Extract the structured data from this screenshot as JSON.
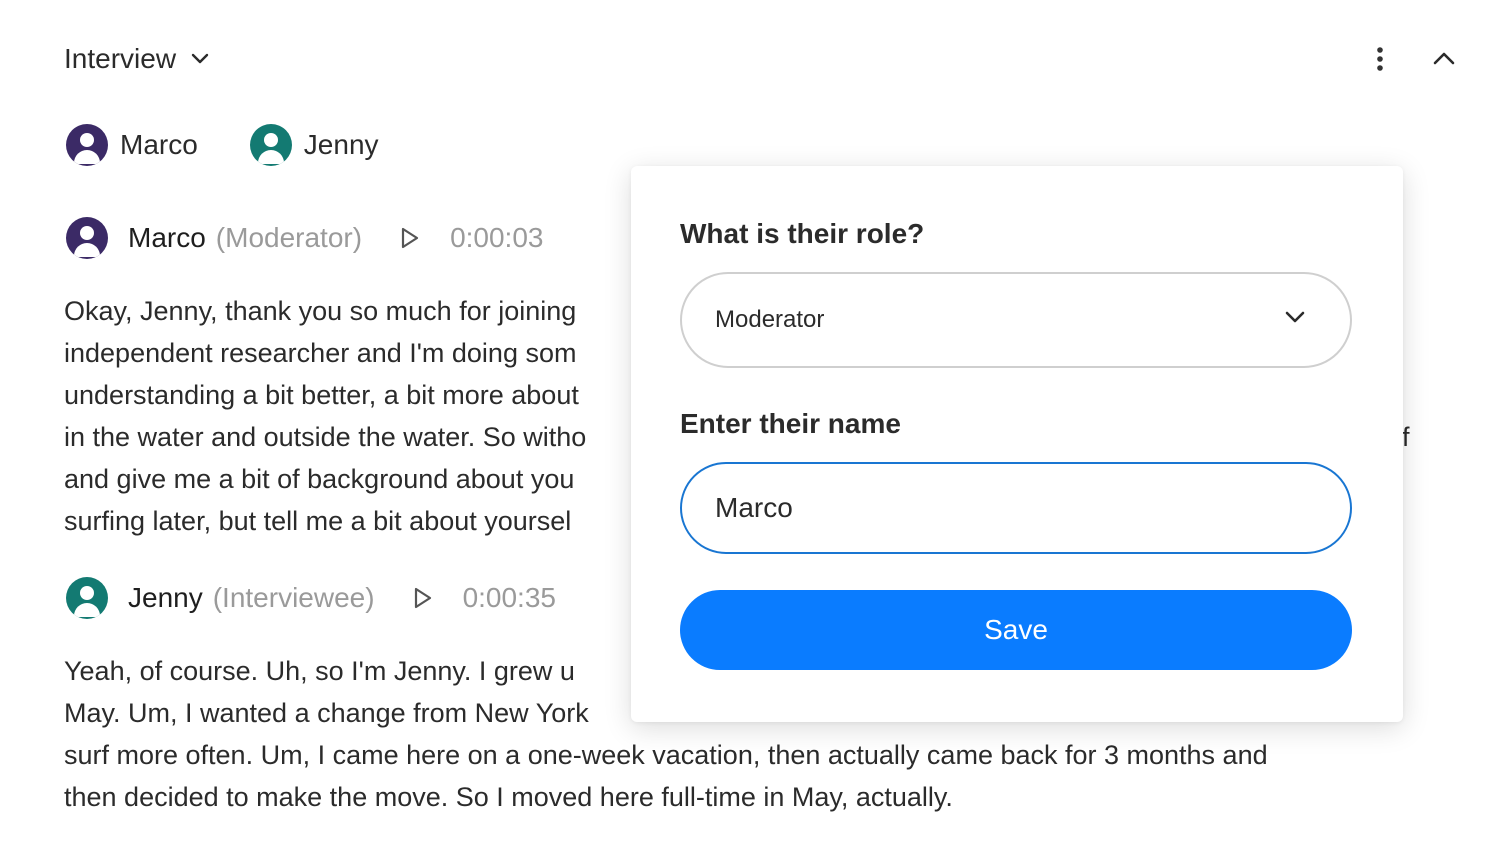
{
  "colors": {
    "marco_avatar": "#3b2a66",
    "jenny_avatar": "#137a72",
    "primary": "#0a7cff",
    "input_focus": "#1976d2",
    "muted_text": "#9a9a9a"
  },
  "header": {
    "title": "Interview",
    "dropdown_icon": "chevron-down-icon",
    "more_icon": "kebab-icon",
    "collapse_icon": "chevron-up-icon"
  },
  "speakers": [
    {
      "name": "Marco",
      "icon": "user-avatar-icon"
    },
    {
      "name": "Jenny",
      "icon": "user-avatar-icon"
    }
  ],
  "utterances": [
    {
      "speaker": "Marco",
      "role": "(Moderator)",
      "time": "0:00:03",
      "lines": [
        "Okay, Jenny, thank you so much for joining",
        "independent researcher and I'm doing som",
        "understanding a bit better, a bit more about",
        "in the water and outside the water. So witho",
        "and give me a bit of background about you",
        "surfing later, but tell me a bit about yoursel"
      ],
      "right_edge_fragments": [
        "",
        "",
        "",
        "f"
      ]
    },
    {
      "speaker": "Jenny",
      "role": "(Interviewee)",
      "time": "0:00:35",
      "lines": [
        "Yeah, of course. Uh, so I'm Jenny. I grew u",
        "May. Um, I wanted a change from New York",
        "surf more often. Um, I came here on a one-week vacation, then actually came back for 3 months and",
        "then decided to make the move. So I moved here full-time in May, actually."
      ]
    }
  ],
  "popover": {
    "role_label": "What is their role?",
    "role_value": "Moderator",
    "name_label": "Enter their name",
    "name_value": "Marco",
    "save_label": "Save"
  }
}
